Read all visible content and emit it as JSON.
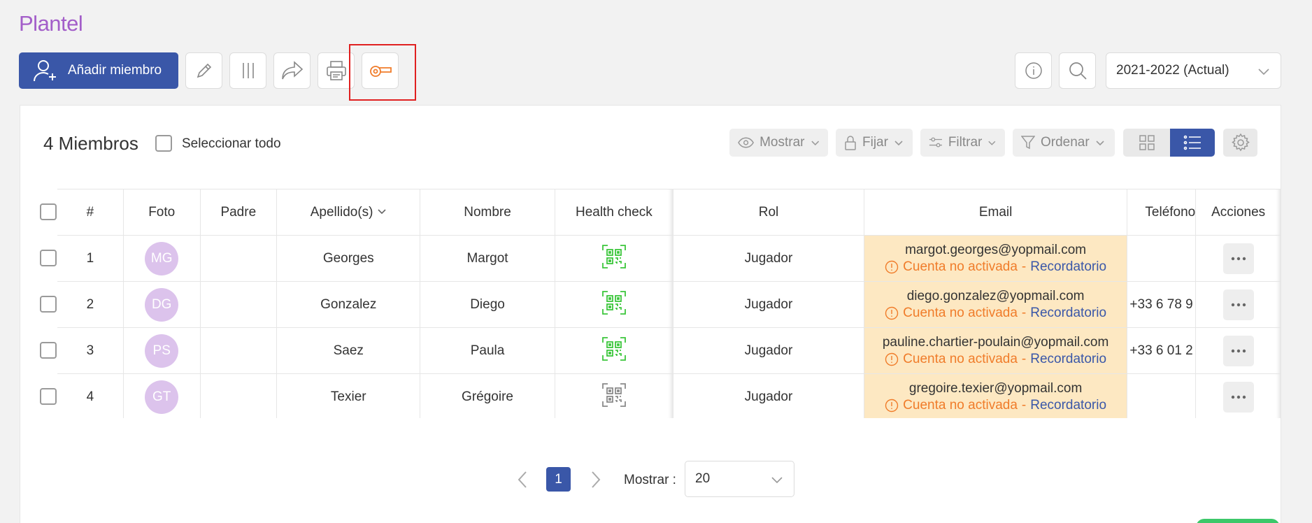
{
  "page": {
    "title": "Plantel"
  },
  "toolbar": {
    "add_member_label": "Añadir miembro",
    "season_value": "2021-2022 (Actual)"
  },
  "list": {
    "count_label": "4 Miembros",
    "select_all_label": "Seleccionar todo",
    "controls": {
      "show": "Mostrar",
      "pin": "Fijar",
      "filter": "Filtrar",
      "sort": "Ordenar"
    }
  },
  "table": {
    "headers": {
      "index": "#",
      "photo": "Foto",
      "parent": "Padre",
      "surname": "Apellido(s)",
      "name": "Nombre",
      "health": "Health check",
      "role": "Rol",
      "email": "Email",
      "phone": "Teléfono",
      "actions": "Acciones"
    },
    "status_text": "Cuenta no activada",
    "separator": "-",
    "reminder_text": "Recordatorio",
    "rows": [
      {
        "index": "1",
        "initials": "MG",
        "surname": "Georges",
        "name": "Margot",
        "health_ok": true,
        "role": "Jugador",
        "email": "margot.georges@yopmail.com",
        "phone": ""
      },
      {
        "index": "2",
        "initials": "DG",
        "surname": "Gonzalez",
        "name": "Diego",
        "health_ok": true,
        "role": "Jugador",
        "email": "diego.gonzalez@yopmail.com",
        "phone": "+33 6 78 9"
      },
      {
        "index": "3",
        "initials": "PS",
        "surname": "Saez",
        "name": "Paula",
        "health_ok": true,
        "role": "Jugador",
        "email": "pauline.chartier-poulain@yopmail.com",
        "phone": "+33 6 01 2"
      },
      {
        "index": "4",
        "initials": "GT",
        "surname": "Texier",
        "name": "Grégoire",
        "health_ok": false,
        "role": "Jugador",
        "email": "gregoire.texier@yopmail.com",
        "phone": ""
      }
    ]
  },
  "pagination": {
    "current_page": "1",
    "show_label": "Mostrar :",
    "per_page": "20"
  },
  "colors": {
    "brand": "#3a57a8",
    "title": "#a35ec9",
    "whistle": "#f07c2a",
    "health_ok": "#3cc63c",
    "email_bg": "#fde8c2"
  }
}
